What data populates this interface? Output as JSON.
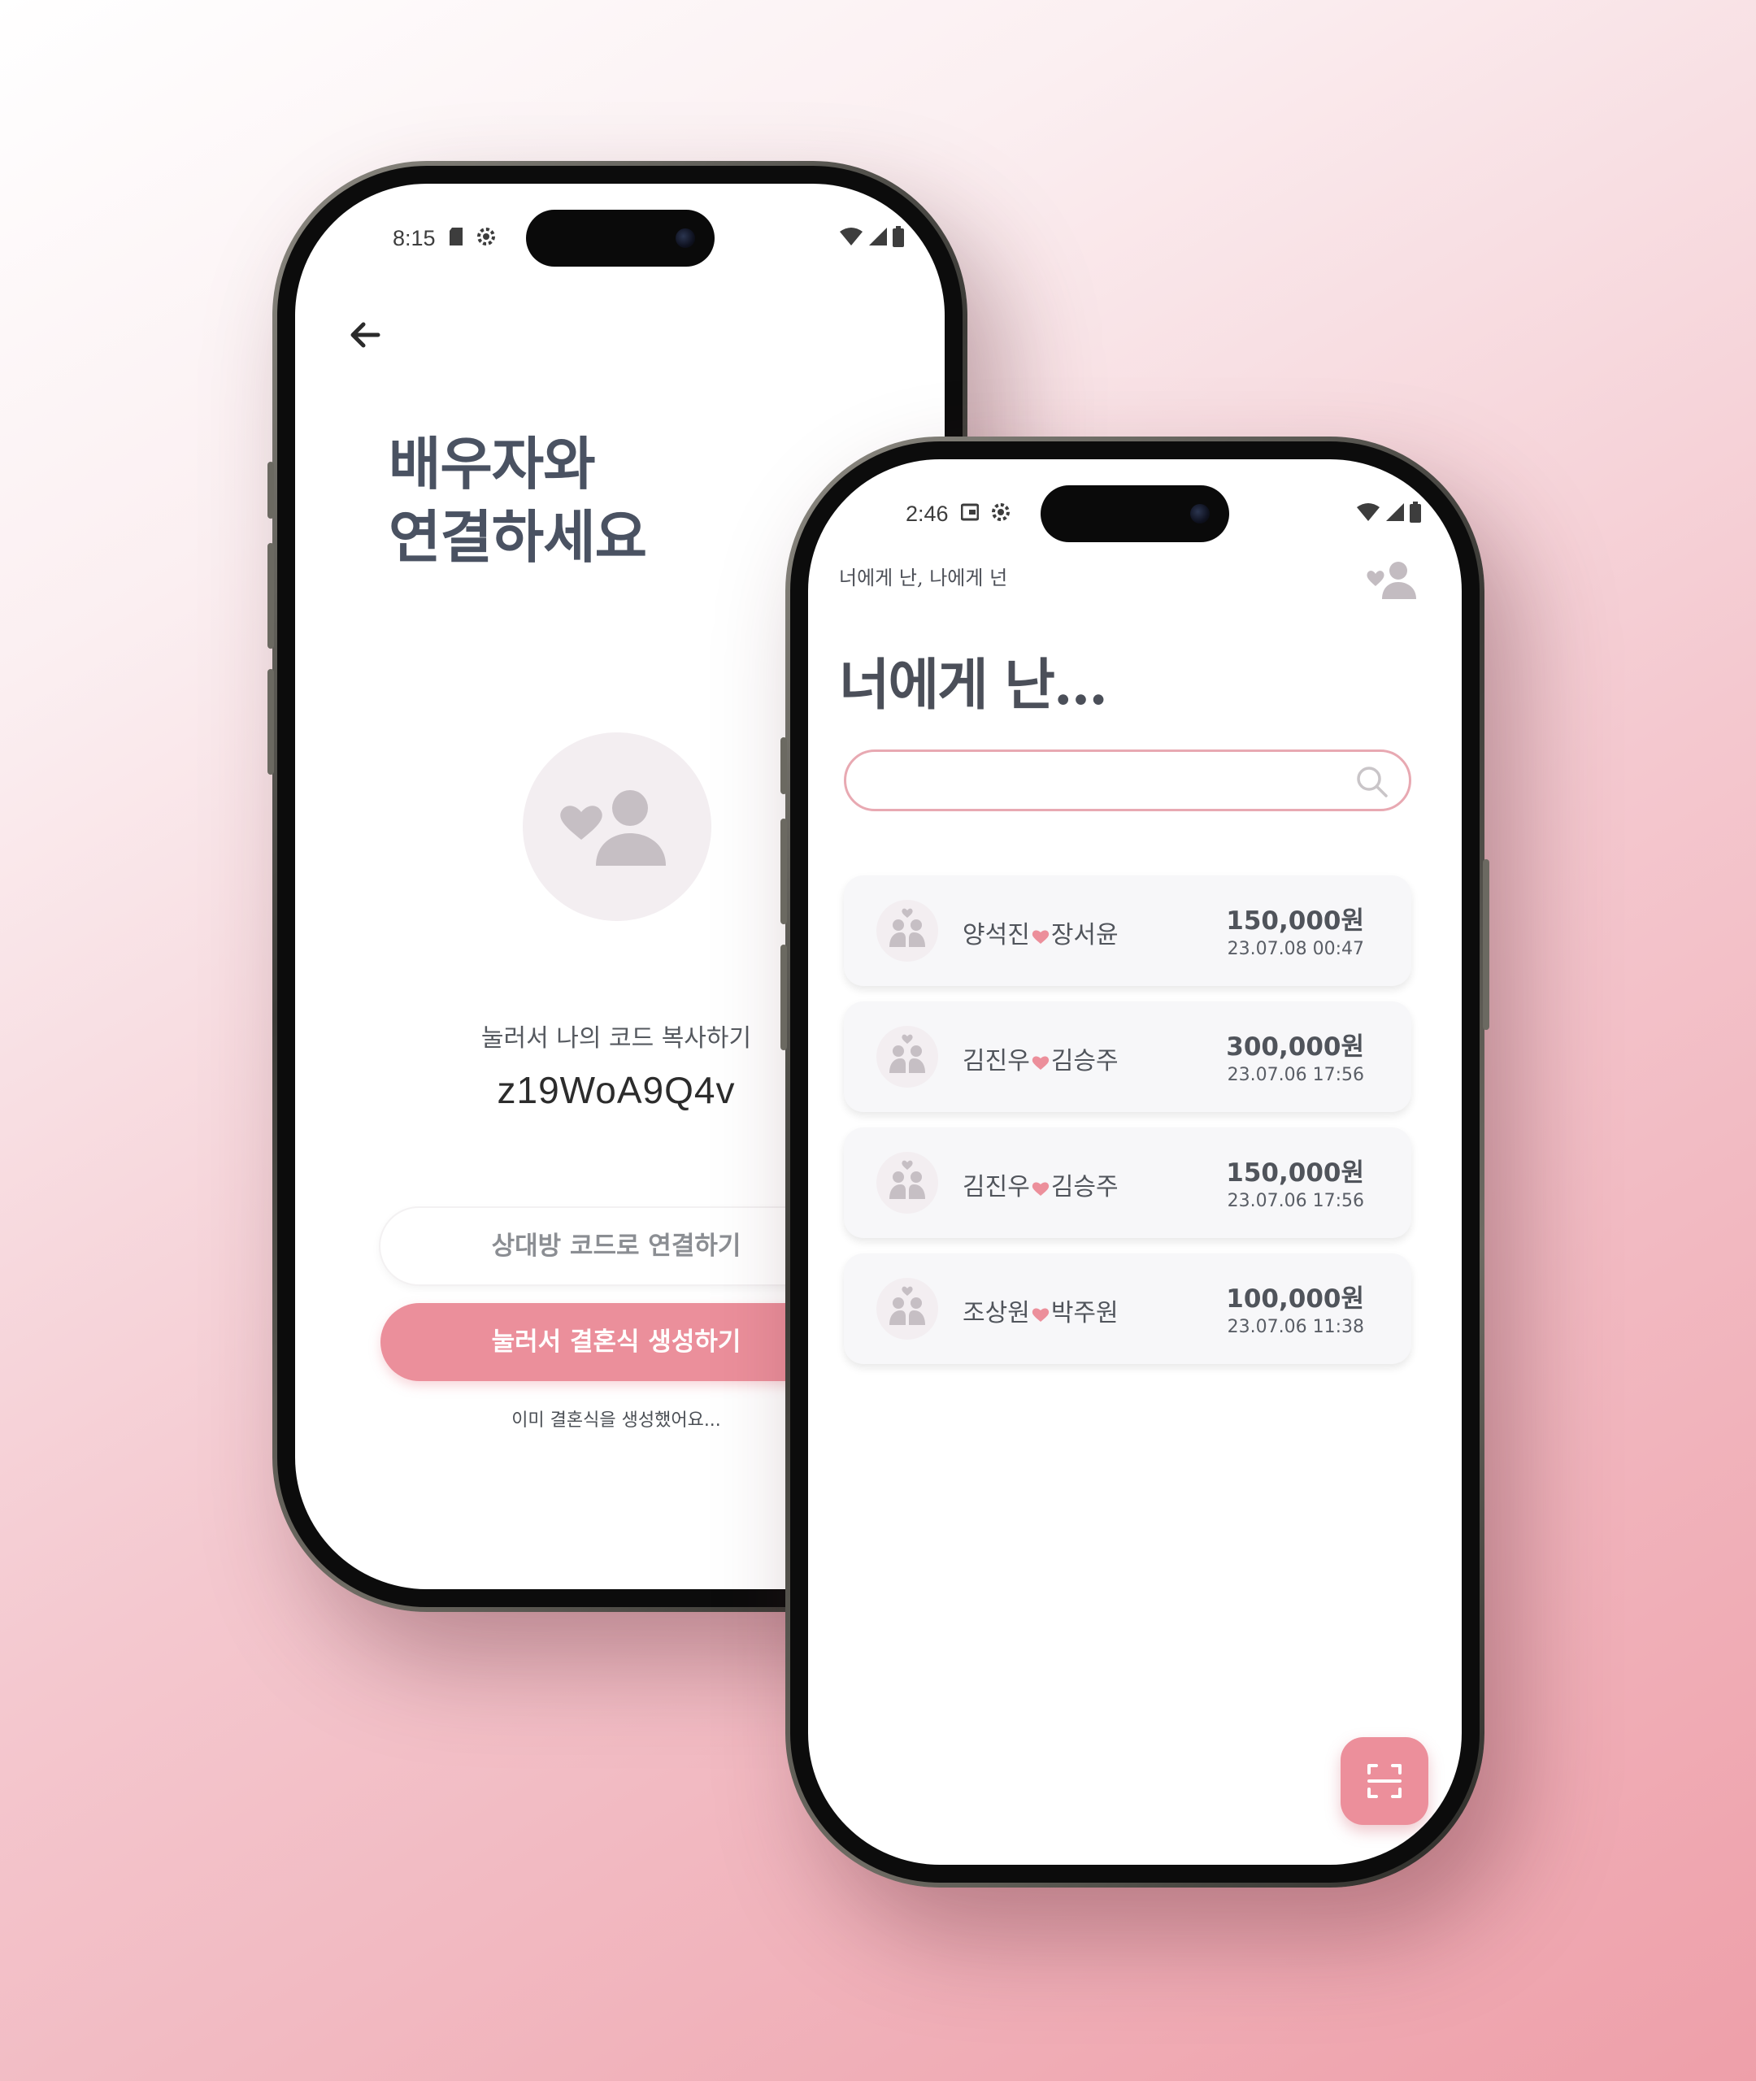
{
  "colors": {
    "accent": "#eb8f9b",
    "accent_border": "#e8a9b2",
    "title_text": "#4a5262",
    "card_bg": "#f7f7f9",
    "avatar_bg": "#f3eef1",
    "avatar_icon": "#c6bfc4"
  },
  "left_phone": {
    "status_bar": {
      "time": "8:15"
    },
    "title": "배우자와\n연결하세요",
    "copy_label": "눌러서 나의 코드 복사하기",
    "my_code": "z19WoA9Q4v",
    "connect_button": "상대방 코드로 연결하기",
    "create_button": "눌러서 결혼식 생성하기",
    "already_link": "이미 결혼식을 생성했어요..."
  },
  "right_phone": {
    "status_bar": {
      "time": "2:46"
    },
    "app_title": "너에게 난, 나에게 넌",
    "headline": "너에게 난...",
    "search": {
      "placeholder": ""
    },
    "weddings": [
      {
        "groom": "양석진",
        "bride": "장서윤",
        "amount": "150,000원",
        "date": "23.07.08  00:47"
      },
      {
        "groom": "김진우",
        "bride": "김승주",
        "amount": "300,000원",
        "date": "23.07.06  17:56"
      },
      {
        "groom": "김진우",
        "bride": "김승주",
        "amount": "150,000원",
        "date": "23.07.06  17:56"
      },
      {
        "groom": "조상원",
        "bride": "박주원",
        "amount": "100,000원",
        "date": "23.07.06  11:38"
      }
    ]
  }
}
